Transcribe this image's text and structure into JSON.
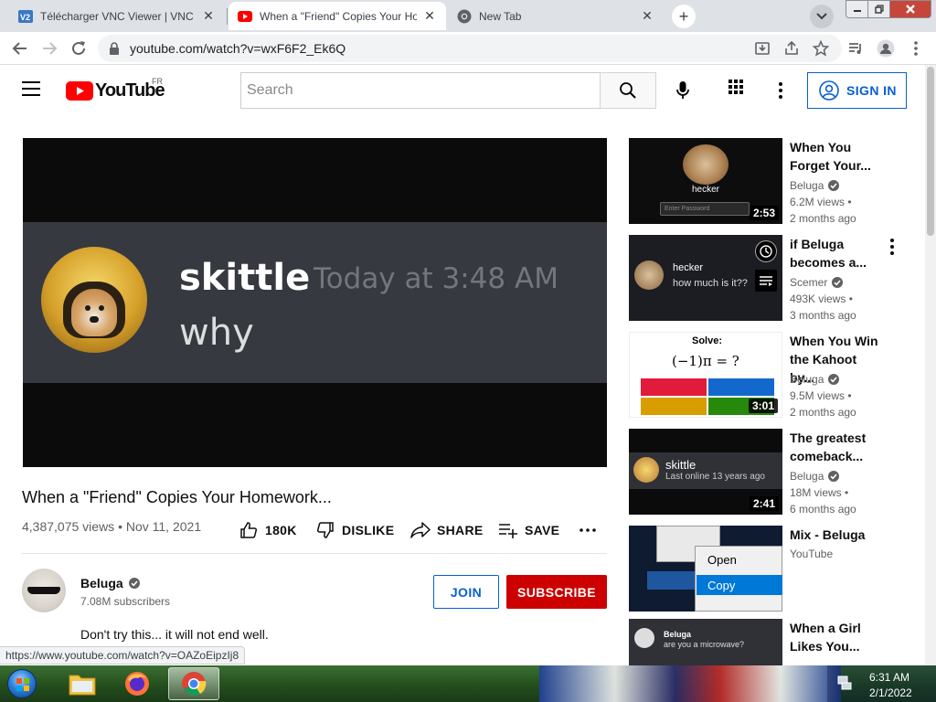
{
  "browser": {
    "tabs": [
      {
        "title": "Télécharger VNC Viewer | VNC Co",
        "favicon": "vnc-icon"
      },
      {
        "title": "When a \"Friend\" Copies Your Ho",
        "favicon": "youtube-icon",
        "active": true
      },
      {
        "title": "New Tab",
        "favicon": "chrome-icon"
      }
    ],
    "url": "youtube.com/watch?v=wxF6F2_Ek6Q"
  },
  "yt": {
    "logo_text": "YouTube",
    "country_code": "FR",
    "search_placeholder": "Search",
    "sign_in": "SIGN IN"
  },
  "player": {
    "username": "skittle",
    "timestamp": "Today at 3:48 AM",
    "message": "why"
  },
  "video": {
    "title": "When a \"Friend\" Copies Your Homework...",
    "meta": "4,387,075 views • Nov 11, 2021",
    "likes": "180K",
    "dislike": "DISLIKE",
    "share": "SHARE",
    "save": "SAVE"
  },
  "channel": {
    "name": "Beluga",
    "subscribers": "7.08M subscribers",
    "join": "JOIN",
    "subscribe": "SUBSCRIBE",
    "description": "Don't try this... it will not end well."
  },
  "status_url": "https://www.youtube.com/watch?v=OAZoEipzIj8",
  "recommendations": [
    {
      "title_1": "When You",
      "title_2": "Forget Your...",
      "channel": "Beluga",
      "verified": true,
      "views": "6.2M views •",
      "age": "2 months ago",
      "duration": "2:53",
      "thumb_text": "hecker",
      "thumb_text2": "Enter Password"
    },
    {
      "title_1": "if Beluga",
      "title_2": "becomes a...",
      "channel": "Scemer",
      "verified": true,
      "views": "493K views •",
      "age": "3 months ago",
      "duration": "",
      "thumb_text": "hecker",
      "thumb_text2": "how much is it??"
    },
    {
      "title_1": "When You Win",
      "title_2": "the Kahoot by...",
      "channel": "Beluga",
      "verified": true,
      "views": "9.5M views •",
      "age": "2 months ago",
      "duration": "3:01",
      "thumb_text": "Solve:",
      "thumb_text2": "(−1)π = ?"
    },
    {
      "title_1": "The greatest",
      "title_2": "comeback...",
      "channel": "Beluga",
      "verified": true,
      "views": "18M views •",
      "age": "6 months ago",
      "duration": "2:41",
      "thumb_text": "skittle",
      "thumb_text2": "Last online 13 years ago"
    },
    {
      "title_1": "Mix - Beluga",
      "title_2": "",
      "channel": "YouTube",
      "verified": false,
      "views": "",
      "age": "",
      "duration": "",
      "thumb_text": "Open",
      "thumb_text2": "Copy"
    },
    {
      "title_1": "When a Girl",
      "title_2": "Likes You...",
      "channel": "",
      "verified": false,
      "views": "",
      "age": "",
      "duration": "",
      "thumb_text": "Beluga",
      "thumb_text2": "are you a microwave?"
    }
  ],
  "taskbar": {
    "time": "6:31 AM",
    "date": "2/1/2022"
  },
  "colors": {
    "yt_red": "#ff0000",
    "subscribe_red": "#cc0000",
    "link_blue": "#065fd4"
  }
}
